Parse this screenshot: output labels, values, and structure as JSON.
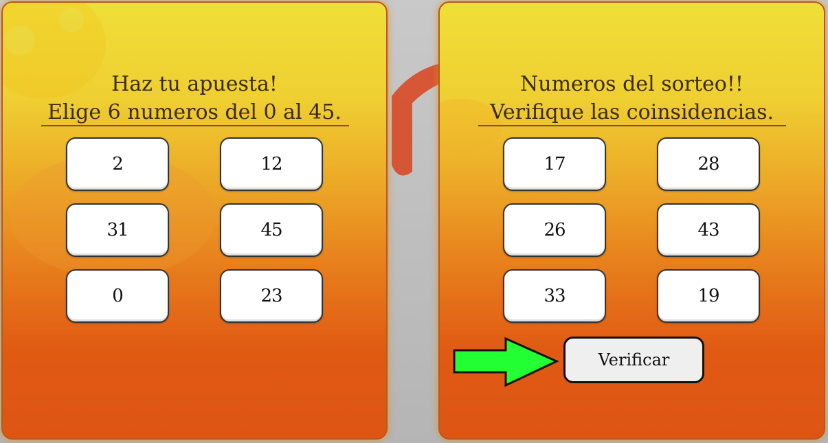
{
  "bet_panel": {
    "title_line1": "Haz tu apuesta!",
    "title_line2": "Elige 6 numeros del 0 al 45.",
    "numbers": [
      "2",
      "12",
      "31",
      "45",
      "0",
      "23"
    ]
  },
  "draw_panel": {
    "title_line1": "Numeros del sorteo!!",
    "title_line2": "Verifique las coinsidencias.",
    "numbers": [
      "17",
      "28",
      "26",
      "43",
      "33",
      "19"
    ],
    "verify_label": "Verificar"
  },
  "colors": {
    "panel_top": "#f0df38",
    "panel_bottom": "#de5513",
    "arrow": "#22ff33"
  },
  "icons": {
    "arrow": "arrow-right-icon"
  }
}
